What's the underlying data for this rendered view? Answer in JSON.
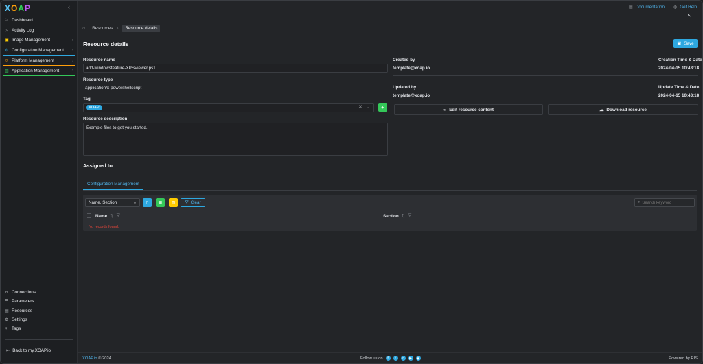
{
  "logo": "XOAP",
  "sidebar": {
    "items": [
      {
        "label": "Dashboard",
        "icon": "home-icon"
      },
      {
        "label": "Activity Log",
        "icon": "clock-icon"
      },
      {
        "label": "Image Management",
        "icon": "image-icon",
        "accent": "#ffcc00"
      },
      {
        "label": "Configuration Management",
        "icon": "config-icon",
        "accent": "#2ea8e0"
      },
      {
        "label": "Platform Management",
        "icon": "platform-icon",
        "accent": "#ff9f0a"
      },
      {
        "label": "Application Management",
        "icon": "app-icon",
        "accent": "#34c759"
      }
    ],
    "bottom_items": [
      {
        "label": "Connections",
        "icon": "link-icon"
      },
      {
        "label": "Parameters",
        "icon": "list-icon"
      },
      {
        "label": "Resources",
        "icon": "resource-icon"
      },
      {
        "label": "Settings",
        "icon": "gear-icon"
      },
      {
        "label": "Tags",
        "icon": "tag-icon"
      }
    ],
    "back_label": "Back to my.XOAP.io"
  },
  "topbar": {
    "documentation": "Documentation",
    "get_help": "Get Help"
  },
  "breadcrumb": {
    "resources": "Resources",
    "current": "Resource details"
  },
  "page": {
    "title": "Resource details",
    "save_label": "Save"
  },
  "form": {
    "resource_name_label": "Resource name",
    "resource_name_value": "add-windowsfeature-XPSViewer.ps1",
    "resource_type_label": "Resource type",
    "resource_type_value": "application/x-powershellscript",
    "tag_label": "Tag",
    "tag_value": "XOAP",
    "description_label": "Resource description",
    "description_value": "Example files to get you started."
  },
  "meta": {
    "created_by_label": "Created by",
    "created_by_value": "template@xoap.io",
    "creation_time_label": "Creation Time & Date",
    "creation_time_value": "2024-04-15 10:43:18",
    "updated_by_label": "Updated by",
    "updated_by_value": "template@xoap.io",
    "update_time_label": "Update Time & Date",
    "update_time_value": "2024-04-15 10:43:18"
  },
  "actions": {
    "edit_content": "Edit resource content",
    "download": "Download resource"
  },
  "assigned": {
    "title": "Assigned to",
    "tab": "Configuration Management",
    "select_value": "Name, Section",
    "clear_label": "Clear",
    "search_placeholder": "Search keyword",
    "columns": [
      "Name",
      "Section"
    ],
    "empty_message": "No records found."
  },
  "footer": {
    "brand": "XOAP.io",
    "year": "© 2024",
    "follow": "Follow us on",
    "powered": "Powered by RIS"
  },
  "colors": {
    "accent": "#2ea8e0",
    "success": "#34c759",
    "warning": "#ffcc00",
    "danger": "#e0453a"
  }
}
